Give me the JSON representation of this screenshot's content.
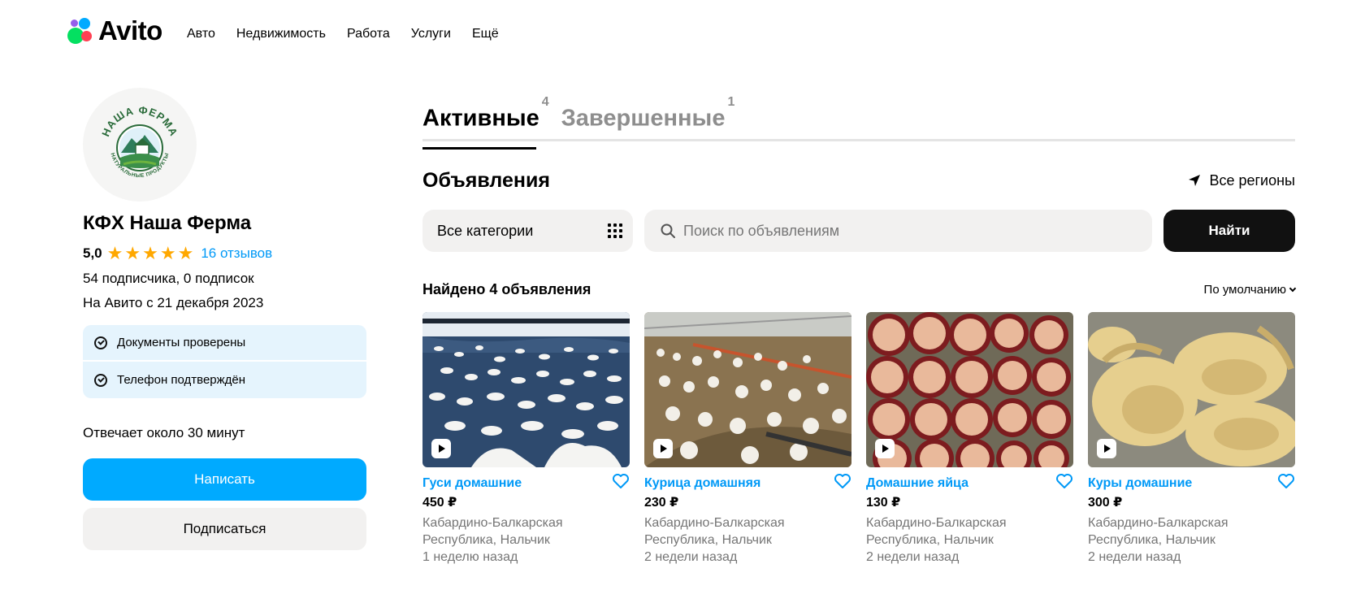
{
  "header": {
    "logo_text": "Avito",
    "nav": [
      "Авто",
      "Недвижимость",
      "Работа",
      "Услуги",
      "Ещё"
    ]
  },
  "seller": {
    "name": "КФХ Наша Ферма",
    "rating": "5,0",
    "stars": 5,
    "reviews": "16 отзывов",
    "subscribers": "54 подписчика, 0 подписок",
    "since": "На Авито с 21 декабря 2023",
    "verifications": [
      "Документы проверены",
      "Телефон подтверждён"
    ],
    "response_time": "Отвечает около 30 минут",
    "write_button": "Написать",
    "subscribe_button": "Подписаться",
    "logo_text_top": "НАША ФЕРМА",
    "logo_text_bottom": "НАТУРАЛЬНЫЕ ПРОДУКТЫ"
  },
  "tabs": [
    {
      "label": "Активные",
      "count": "4"
    },
    {
      "label": "Завершенные",
      "count": "1"
    }
  ],
  "listings_section": {
    "title": "Объявления",
    "regions": "Все регионы",
    "category": "Все категории",
    "search_placeholder": "Поиск по объявлениям",
    "search_button": "Найти",
    "found": "Найдено 4 объявления",
    "sort": "По умолчанию"
  },
  "cards": [
    {
      "title": "Гуси домашние",
      "price": "450 ₽",
      "location_line1": "Кабардино-Балкарская",
      "location_line2": "Республика, Нальчик",
      "date": "1 неделю назад"
    },
    {
      "title": "Курица домашняя",
      "price": "230 ₽",
      "location_line1": "Кабардино-Балкарская",
      "location_line2": "Республика, Нальчик",
      "date": "2 недели назад"
    },
    {
      "title": "Домашние яйца",
      "price": "130 ₽",
      "location_line1": "Кабардино-Балкарская",
      "location_line2": "Республика, Нальчик",
      "date": "2 недели назад"
    },
    {
      "title": "Куры домашние",
      "price": "300 ₽",
      "location_line1": "Кабардино-Балкарская",
      "location_line2": "Республика, Нальчик",
      "date": "2 недели назад"
    }
  ],
  "colors": {
    "accent_blue": "#00aaff",
    "link_blue": "#0099f7",
    "star": "#ffa800",
    "verify_bg": "#e5f4fd"
  }
}
